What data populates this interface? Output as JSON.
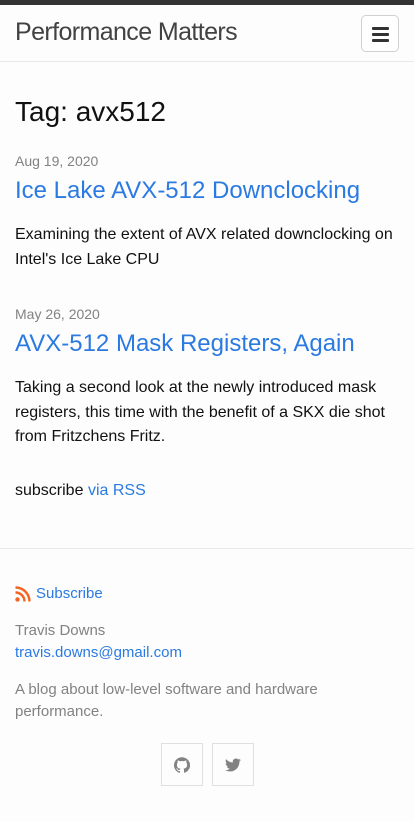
{
  "header": {
    "site_title": "Performance Matters",
    "menu_icon": "hamburger-menu-icon"
  },
  "page": {
    "heading": "Tag: avx512"
  },
  "posts": [
    {
      "date": "Aug 19, 2020",
      "title": "Ice Lake AVX-512 Downclocking",
      "excerpt": "Examining the extent of AVX related downclocking on Intel's Ice Lake CPU"
    },
    {
      "date": "May 26, 2020",
      "title": "AVX-512 Mask Registers, Again",
      "excerpt": "Taking a second look at the newly introduced mask registers, this time with the benefit of a SKX die shot from Fritzchens Fritz."
    }
  ],
  "subscribe": {
    "prefix": "subscribe",
    "link_label": "via RSS"
  },
  "footer": {
    "rss_label": "Subscribe",
    "rss_icon": "rss-icon",
    "author_name": "Travis Downs",
    "email": "travis.downs@gmail.com",
    "description": "A blog about low-level software and hardware performance.",
    "social_icons": [
      "github-icon",
      "twitter-icon"
    ]
  },
  "colors": {
    "link": "#2a7ae2",
    "muted": "#828282",
    "rss": "#f26522",
    "topbar": "#333333"
  }
}
